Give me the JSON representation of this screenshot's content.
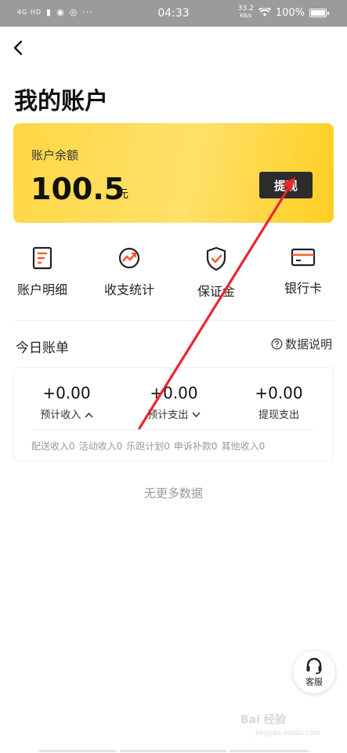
{
  "status_bar": {
    "network": "4G HD",
    "time": "04:33",
    "speed_value": "33.2",
    "speed_unit": "KB/s",
    "battery": "100%"
  },
  "page": {
    "title": "我的账户"
  },
  "balance_card": {
    "label": "账户余额",
    "amount": "100.5",
    "unit": "元",
    "withdraw_label": "提现"
  },
  "menu": [
    {
      "label": "账户明细",
      "icon": "document-list-icon"
    },
    {
      "label": "收支统计",
      "icon": "trend-chart-icon"
    },
    {
      "label": "保证金",
      "icon": "shield-check-icon"
    },
    {
      "label": "银行卡",
      "icon": "bank-card-icon"
    }
  ],
  "today_bill": {
    "title": "今日账单",
    "info_label": "数据说明",
    "stats": [
      {
        "value": "+0.00",
        "label": "预计收入",
        "chevron": "up"
      },
      {
        "value": "+0.00",
        "label": "预计支出",
        "chevron": "down"
      },
      {
        "value": "+0.00",
        "label": "提现支出",
        "chevron": ""
      }
    ],
    "details": [
      "配送收入0",
      "活动收入0",
      "乐跑计划0",
      "申诉补款0",
      "其他收入0"
    ]
  },
  "footer": {
    "no_more": "无更多数据"
  },
  "support": {
    "label": "客服"
  },
  "watermark": {
    "brand": "Bai 经验",
    "url": "jingyan.baidu.com"
  },
  "colors": {
    "accent_yellow": "#ffd844",
    "icon_orange": "#ff5a2c",
    "annotation_red": "#e8262e"
  }
}
